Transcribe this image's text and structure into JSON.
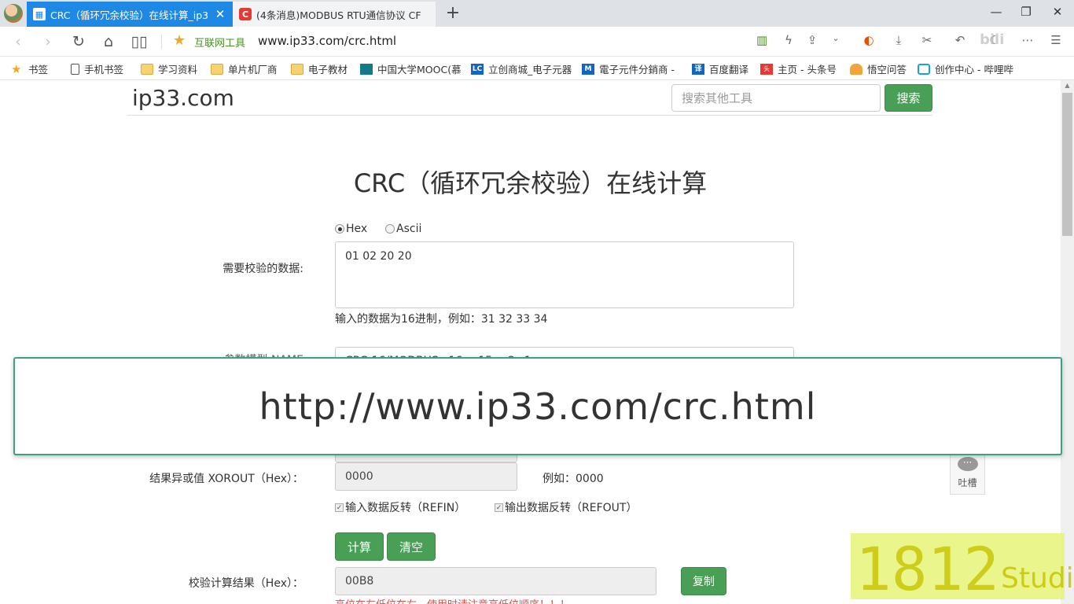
{
  "browser": {
    "tabs": [
      {
        "title": "CRC（循环冗余校验）在线计算_ip3",
        "icon": "calculator-icon"
      },
      {
        "title": "(4条消息)MODBUS RTU通信协议 CF",
        "icon": "csdn-icon"
      }
    ],
    "new_tab": "+",
    "window": {
      "minimize": "—",
      "restore": "❐",
      "close": "✕"
    },
    "site_label": "互联网工具",
    "url": "www.ip33.com/crc.html",
    "bookmarks": [
      "书签",
      "手机书签",
      "学习资料",
      "单片机厂商",
      "电子教材",
      "中国大学MOOC(慕",
      "立创商城_电子元器",
      "電子元件分銷商 -",
      "百度翻译",
      "主页 - 头条号",
      "悟空问答",
      "创作中心 - 哔哩哔"
    ]
  },
  "page": {
    "brand": "ip33.com",
    "search_placeholder": "搜索其他工具",
    "search_button": "搜索",
    "title": "CRC（循环冗余校验）在线计算",
    "format_options": {
      "hex": "Hex",
      "ascii": "Ascii",
      "selected": "hex"
    },
    "data_label": "需要校验的数据:",
    "data_value": "01 02 20 20",
    "data_help": "输入的数据为16进制，例如：31 32 33 34",
    "model_label_partial": "参数模型 NAME",
    "model_value_partial": "CRC-16/MODBUS     x16+x15+x2+1",
    "xorout_label": "结果异或值 XOROUT（Hex）：",
    "xorout_value": "0000",
    "xorout_example": "例如：0000",
    "refin_label": "输入数据反转（REFIN）",
    "refout_label": "输出数据反转（REFOUT）",
    "calc_button": "计算",
    "clear_button": "清空",
    "result_label": "校验计算结果（Hex）：",
    "result_value": "00B8",
    "copy_button": "复制",
    "warning": "高位在左低位在右，使用时请注意高低位顺序！！！",
    "feedback": "吐槽"
  },
  "overlay": {
    "text": "http://www.ip33.com/crc.html"
  },
  "watermark": {
    "number": "1812",
    "suffix": "Studio"
  },
  "colors": {
    "accent_blue": "#1e88e5",
    "button_green": "#4a9f57",
    "overlay_border": "#3aa37f",
    "warning_red": "#d9534f"
  }
}
